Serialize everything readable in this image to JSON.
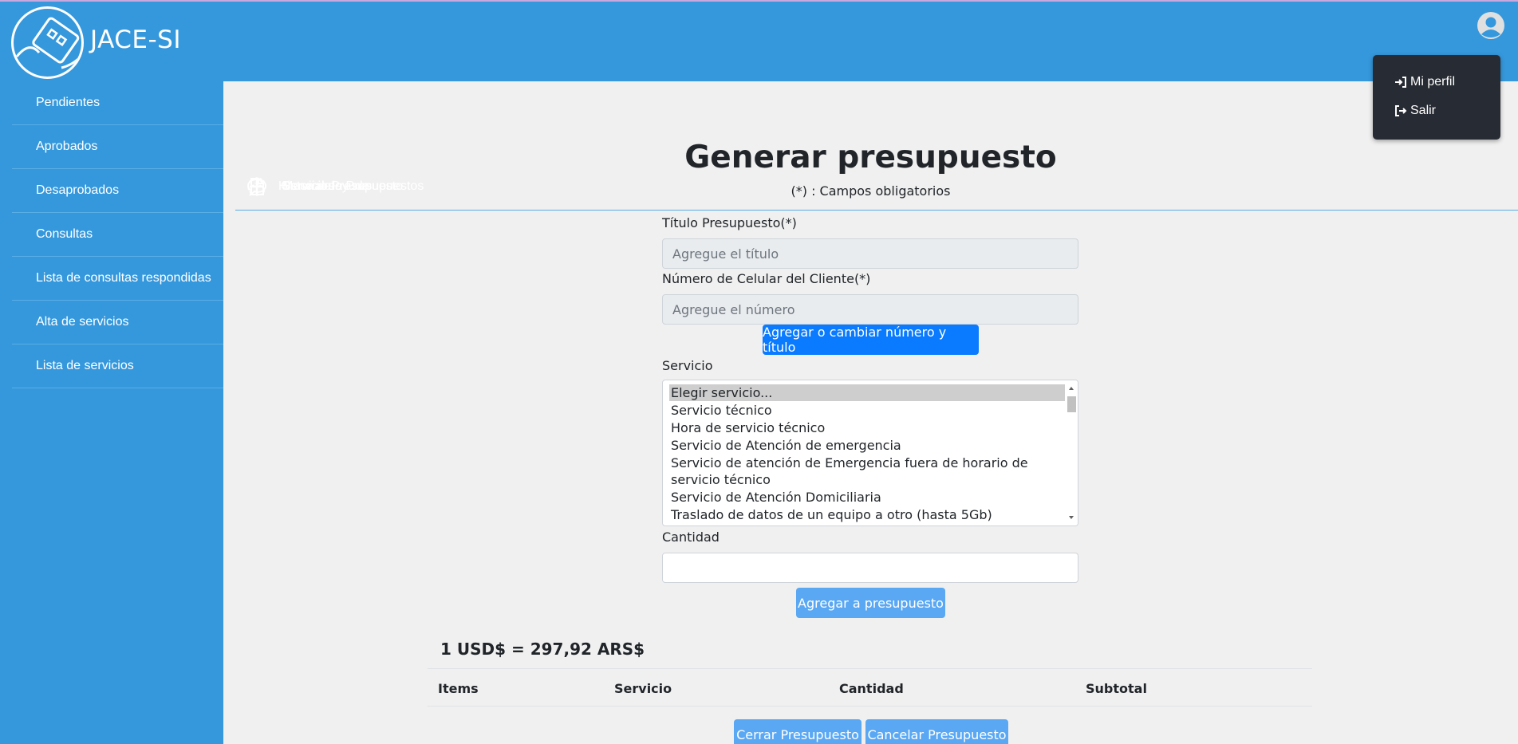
{
  "app": {
    "brand": "JACE-SI"
  },
  "user_menu": {
    "items": [
      {
        "label": "Mi perfil",
        "icon": "sign-in-icon"
      },
      {
        "label": "Salir",
        "icon": "sign-out-icon"
      }
    ]
  },
  "sidebar": {
    "generar": "Generar Presupuesto",
    "historial": "Historial de Presupuestos",
    "pendientes": "Pendientes",
    "aprobados": "Aprobados",
    "desaprobados": "Desaprobados",
    "mesa": "Mesa de ayuda",
    "consultas": "Consultas",
    "lista_consultas": "Lista de consultas respondidas",
    "servicios": "Servicios",
    "alta_servicios": "Alta de servicios",
    "lista_servicios": "Lista de servicios"
  },
  "form": {
    "title": "Generar presupuesto",
    "subtitle": "(*) : Campos obligatorios",
    "titulo_label": "Título Presupuesto(*)",
    "titulo_placeholder": "Agregue el título",
    "celular_label": "Número de Celular del Cliente(*)",
    "celular_placeholder": "Agregue el número",
    "agregar_btn": "Agregar o cambiar número y título",
    "servicio_label": "Servicio",
    "servicio_options": [
      "Elegir servicio...",
      "Servicio técnico",
      "Hora de servicio técnico",
      "Servicio de Atención de emergencia",
      "Servicio de atención de Emergencia fuera de horario de servicio técnico",
      "Servicio de Atención Domiciliaria",
      "Traslado de datos de un equipo a otro (hasta 5Gb)"
    ],
    "cantidad_label": "Cantidad",
    "cantidad_value": "",
    "agregar_presupuesto_btn": "Agregar a presupuesto"
  },
  "rate": "1 USD$ = 297,92 ARS$",
  "table": {
    "headers": [
      "Items",
      "Servicio",
      "Cantidad",
      "Subtotal"
    ]
  },
  "actions": {
    "cerrar": "Cerrar Presupuesto",
    "cancelar": "Cancelar Presupuesto"
  },
  "colors": {
    "brand": "#3598dc",
    "primary": "#0a7bff",
    "dropdown_bg": "#272b33"
  }
}
